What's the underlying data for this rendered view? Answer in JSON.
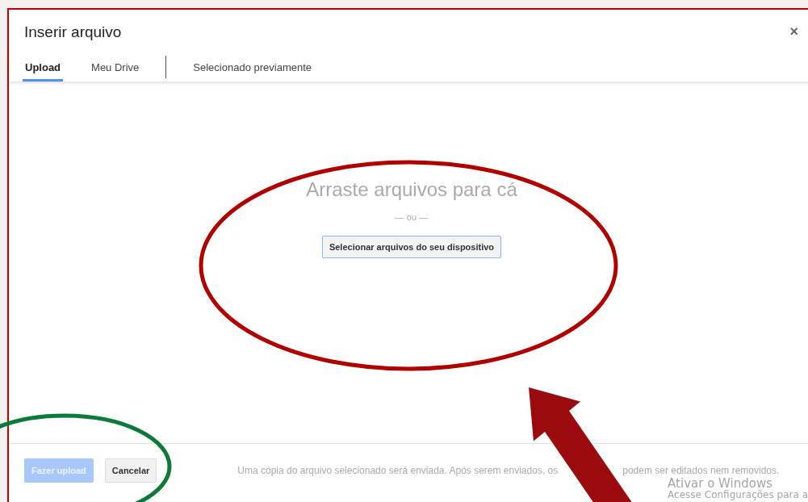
{
  "dialog": {
    "title": "Inserir arquivo",
    "close": "×"
  },
  "tabs": [
    {
      "kind": "tab",
      "label": "Upload",
      "selected": true
    },
    {
      "kind": "tab",
      "label": "Meu Drive",
      "selected": false
    },
    {
      "kind": "divider"
    },
    {
      "kind": "tab",
      "label": "Selecionado previamente",
      "selected": false
    }
  ],
  "dropzone": {
    "heading": "Arraste arquivos para cá",
    "separator": "— ou —",
    "button": "Selecionar arquivos do seu dispositivo"
  },
  "footer": {
    "buttons": [
      {
        "label": "Fazer upload",
        "disabled": true,
        "primary": true
      },
      {
        "label": "Cancelar",
        "disabled": false,
        "primary": false
      }
    ],
    "note_parts": [
      "Uma cópia do arquivo selecionado será enviada. Após serem enviados, os",
      "podem ser editados nem removidos."
    ]
  },
  "windows_notice": {
    "title": "Ativar o Windows",
    "text": "Acesse Configurações para a"
  }
}
